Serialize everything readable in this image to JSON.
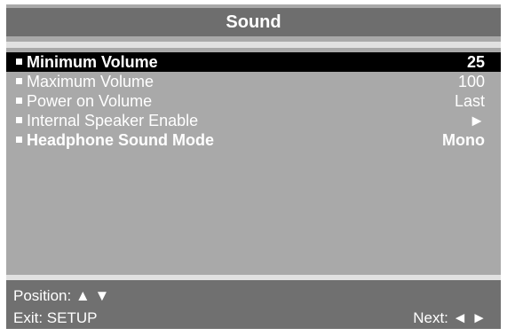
{
  "menu": {
    "title": "Sound",
    "items": [
      {
        "label": "Minimum Volume",
        "value": "25"
      },
      {
        "label": "Maximum Volume",
        "value": "100"
      },
      {
        "label": "Power on Volume",
        "value": "Last"
      },
      {
        "label": "Internal Speaker Enable",
        "value": "►"
      },
      {
        "label": "Headphone Sound Mode",
        "value": "Mono"
      }
    ],
    "selected_index": 0
  },
  "footer": {
    "position": "Position: ▲ ▼",
    "exit": "Exit: SETUP",
    "next": "Next: ◄ ►"
  },
  "colors": {
    "panel": "#a9a9a9",
    "title_bar": "#6e6e6e",
    "separator": "#e1e1e1",
    "selection": "#000000",
    "footer": "#707070",
    "text": "#ffffff"
  }
}
